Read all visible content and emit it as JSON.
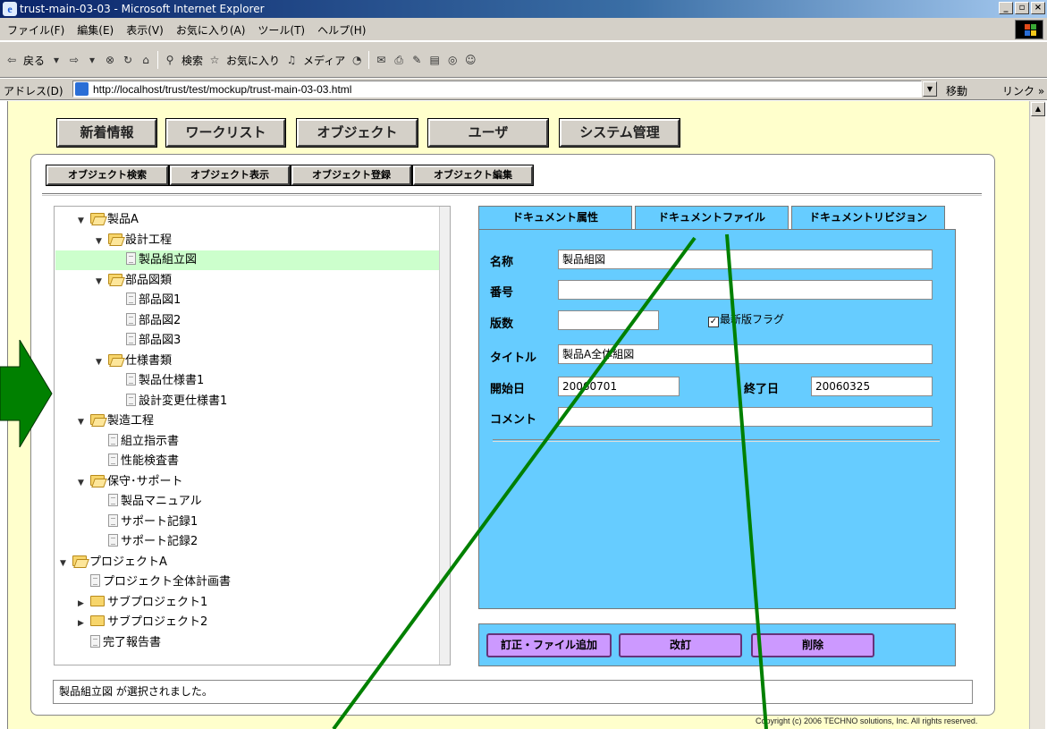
{
  "window": {
    "title": "trust-main-03-03 - Microsoft Internet Explorer",
    "controls": [
      "_",
      "▫",
      "×"
    ]
  },
  "menubar": {
    "items": [
      "ファイル(F)",
      "編集(E)",
      "表示(V)",
      "お気に入り(A)",
      "ツール(T)",
      "ヘルプ(H)"
    ]
  },
  "toolbar": {
    "back": "戻る",
    "search": "検索",
    "favorites": "お気に入り",
    "media": "メディア"
  },
  "addressbar": {
    "label": "アドレス(D)",
    "url": "http://localhost/trust/test/mockup/trust-main-03-03.html",
    "go": "移動",
    "links": "リンク »"
  },
  "nav": {
    "items": [
      "新着情報",
      "ワークリスト",
      "オブジェクト",
      "ユーザ",
      "システム管理"
    ]
  },
  "subnav": {
    "items": [
      "オブジェクト検索",
      "オブジェクト表示",
      "オブジェクト登録",
      "オブジェクト編集"
    ]
  },
  "tree": {
    "nodes": [
      {
        "label": "製品A",
        "type": "folder",
        "toggle": "▼"
      },
      {
        "label": "設計工程",
        "type": "folder",
        "toggle": "▼"
      },
      {
        "label": "製品組立図",
        "type": "doc",
        "toggle": "",
        "selected": true
      },
      {
        "label": "部品図類",
        "type": "folder",
        "toggle": "▼"
      },
      {
        "label": "部品図1",
        "type": "doc",
        "toggle": ""
      },
      {
        "label": "部品図2",
        "type": "doc",
        "toggle": ""
      },
      {
        "label": "部品図3",
        "type": "doc",
        "toggle": ""
      },
      {
        "label": "仕様書類",
        "type": "folder",
        "toggle": "▼"
      },
      {
        "label": "製品仕様書1",
        "type": "doc",
        "toggle": ""
      },
      {
        "label": "設計変更仕様書1",
        "type": "doc",
        "toggle": ""
      },
      {
        "label": "製造工程",
        "type": "folder",
        "toggle": "▼"
      },
      {
        "label": "組立指示書",
        "type": "doc",
        "toggle": ""
      },
      {
        "label": "性能検査書",
        "type": "doc",
        "toggle": ""
      },
      {
        "label": "保守･サポート",
        "type": "folder",
        "toggle": "▼"
      },
      {
        "label": "製品マニュアル",
        "type": "doc",
        "toggle": ""
      },
      {
        "label": "サポート記録1",
        "type": "doc",
        "toggle": ""
      },
      {
        "label": "サポート記録2",
        "type": "doc",
        "toggle": ""
      },
      {
        "label": "プロジェクトA",
        "type": "folder",
        "toggle": "▼"
      },
      {
        "label": "プロジェクト全体計画書",
        "type": "doc",
        "toggle": ""
      },
      {
        "label": "サブプロジェクト1",
        "type": "folder-closed",
        "toggle": "▶"
      },
      {
        "label": "サブプロジェクト2",
        "type": "folder-closed",
        "toggle": "▶"
      },
      {
        "label": "完了報告書",
        "type": "doc",
        "toggle": ""
      }
    ]
  },
  "tabs": {
    "items": [
      "ドキュメント属性",
      "ドキュメントファイル",
      "ドキュメントリビジョン"
    ],
    "active": "ドキュメント属性"
  },
  "form": {
    "name_label": "名称",
    "name_value": "製品組図",
    "number_label": "番号",
    "number_value": "",
    "edition_label": "版数",
    "edition_value": "",
    "latest_flag_label": "最新版フラグ",
    "latest_flag_checked": true,
    "title_label": "タイトル",
    "title_value": "製品A全体組図",
    "start_label": "開始日",
    "start_value": "20060701",
    "end_label": "終了日",
    "end_value": "20060325",
    "comment_label": "コメント",
    "comment_value": ""
  },
  "actions": {
    "correct": "訂正・ファイル追加",
    "revise": "改訂",
    "delete": "削除"
  },
  "status": "製品組立図 が選択されました。",
  "copyright": "Copyright (c) 2006 TECHNO solutions, Inc. All rights reserved.",
  "colors": {
    "page_bg": "#ffffcc",
    "panel_blue": "#66ccff",
    "action_purple": "#cc99ff",
    "selection_green": "#ccffcc",
    "annotation_green": "#008000"
  }
}
